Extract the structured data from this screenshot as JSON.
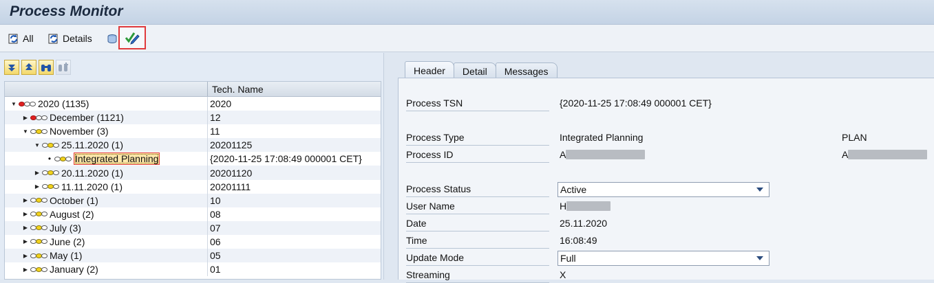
{
  "window": {
    "title": "Process Monitor"
  },
  "toolbar": {
    "all_label": "All",
    "details_label": "Details"
  },
  "tree": {
    "header_tech": "Tech. Name",
    "rows": [
      {
        "label": "2020 (1135)",
        "tech": "2020"
      },
      {
        "label": "December (1121)",
        "tech": "12"
      },
      {
        "label": "November (3)",
        "tech": "11"
      },
      {
        "label": "25.11.2020 (1)",
        "tech": "20201125"
      },
      {
        "label": "Integrated Planning",
        "tech": "{2020-11-25 17:08:49 000001 CET}"
      },
      {
        "label": "20.11.2020 (1)",
        "tech": "20201120"
      },
      {
        "label": "11.11.2020 (1)",
        "tech": "20201111"
      },
      {
        "label": "October (1)",
        "tech": "10"
      },
      {
        "label": "August (2)",
        "tech": "08"
      },
      {
        "label": "July (3)",
        "tech": "07"
      },
      {
        "label": "June (2)",
        "tech": "06"
      },
      {
        "label": "May (1)",
        "tech": "05"
      },
      {
        "label": "January (2)",
        "tech": "01"
      }
    ]
  },
  "tabs": {
    "header": "Header",
    "detail": "Detail",
    "messages": "Messages"
  },
  "details": {
    "process_tsn": {
      "label": "Process TSN",
      "value": "{2020-11-25 17:08:49 000001 CET}"
    },
    "process_type": {
      "label": "Process Type",
      "value": "Integrated Planning",
      "value2": "PLAN"
    },
    "process_id": {
      "label": "Process ID",
      "value": "A",
      "value2": "A"
    },
    "process_status": {
      "label": "Process Status",
      "value": "Active"
    },
    "user_name": {
      "label": "User Name",
      "value": "H"
    },
    "date": {
      "label": "Date",
      "value": "25.11.2020"
    },
    "time": {
      "label": "Time",
      "value": "16:08:49"
    },
    "update_mode": {
      "label": "Update Mode",
      "value": "Full"
    },
    "streaming": {
      "label": "Streaming",
      "value": "X"
    }
  }
}
